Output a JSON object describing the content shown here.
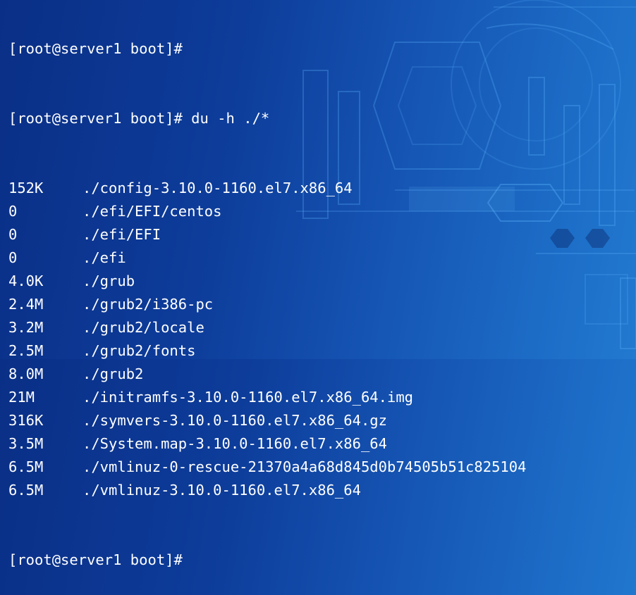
{
  "terminal": {
    "top_prompt": "[root@server1 boot]#",
    "command_prompt": "[root@server1 boot]# du -h ./*",
    "output": [
      {
        "size": "152K",
        "path": "./config-3.10.0-1160.el7.x86_64"
      },
      {
        "size": "0",
        "path": "./efi/EFI/centos"
      },
      {
        "size": "0",
        "path": "./efi/EFI"
      },
      {
        "size": "0",
        "path": "./efi"
      },
      {
        "size": "4.0K",
        "path": "./grub"
      },
      {
        "size": "2.4M",
        "path": "./grub2/i386-pc"
      },
      {
        "size": "3.2M",
        "path": "./grub2/locale"
      },
      {
        "size": "2.5M",
        "path": "./grub2/fonts"
      },
      {
        "size": "8.0M",
        "path": "./grub2"
      },
      {
        "size": "21M",
        "path": "./initramfs-3.10.0-1160.el7.x86_64.img"
      },
      {
        "size": "316K",
        "path": "./symvers-3.10.0-1160.el7.x86_64.gz"
      },
      {
        "size": "3.5M",
        "path": "./System.map-3.10.0-1160.el7.x86_64"
      },
      {
        "size": "6.5M",
        "path": "./vmlinuz-0-rescue-21370a4a68d845d0b74505b51c825104"
      },
      {
        "size": "6.5M",
        "path": "./vmlinuz-3.10.0-1160.el7.x86_64"
      }
    ],
    "bottom_prompt": "[root@server1 boot]#"
  },
  "colors": {
    "text": "#ffffff",
    "background_dark": "#0a2f86",
    "background_light": "#2279cf",
    "decor_line": "#5fb6ff"
  }
}
